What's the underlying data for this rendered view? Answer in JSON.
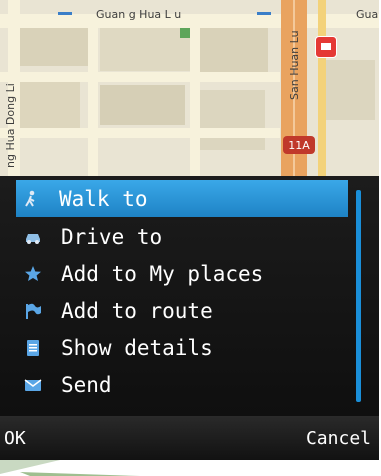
{
  "map": {
    "roads": {
      "top": "Guan g Hua L u",
      "top_right": "Gua",
      "vertical_center": "San Huan Lu",
      "vertical_left": "ng Hua Dong Li"
    },
    "route_badge": "11A"
  },
  "menu": {
    "items": [
      {
        "label": "Walk to",
        "icon": "walk-icon",
        "selected": true
      },
      {
        "label": "Drive to",
        "icon": "car-icon",
        "selected": false
      },
      {
        "label": "Add to My places",
        "icon": "star-icon",
        "selected": false
      },
      {
        "label": "Add to route",
        "icon": "flag-icon",
        "selected": false
      },
      {
        "label": "Show details",
        "icon": "document-icon",
        "selected": false
      },
      {
        "label": "Send",
        "icon": "envelope-icon",
        "selected": false
      }
    ]
  },
  "softkeys": {
    "left": "OK",
    "right": "Cancel"
  },
  "colors": {
    "selection": "#2b96d8",
    "menu_bg": "#161616",
    "route_badge": "#c0392b"
  }
}
